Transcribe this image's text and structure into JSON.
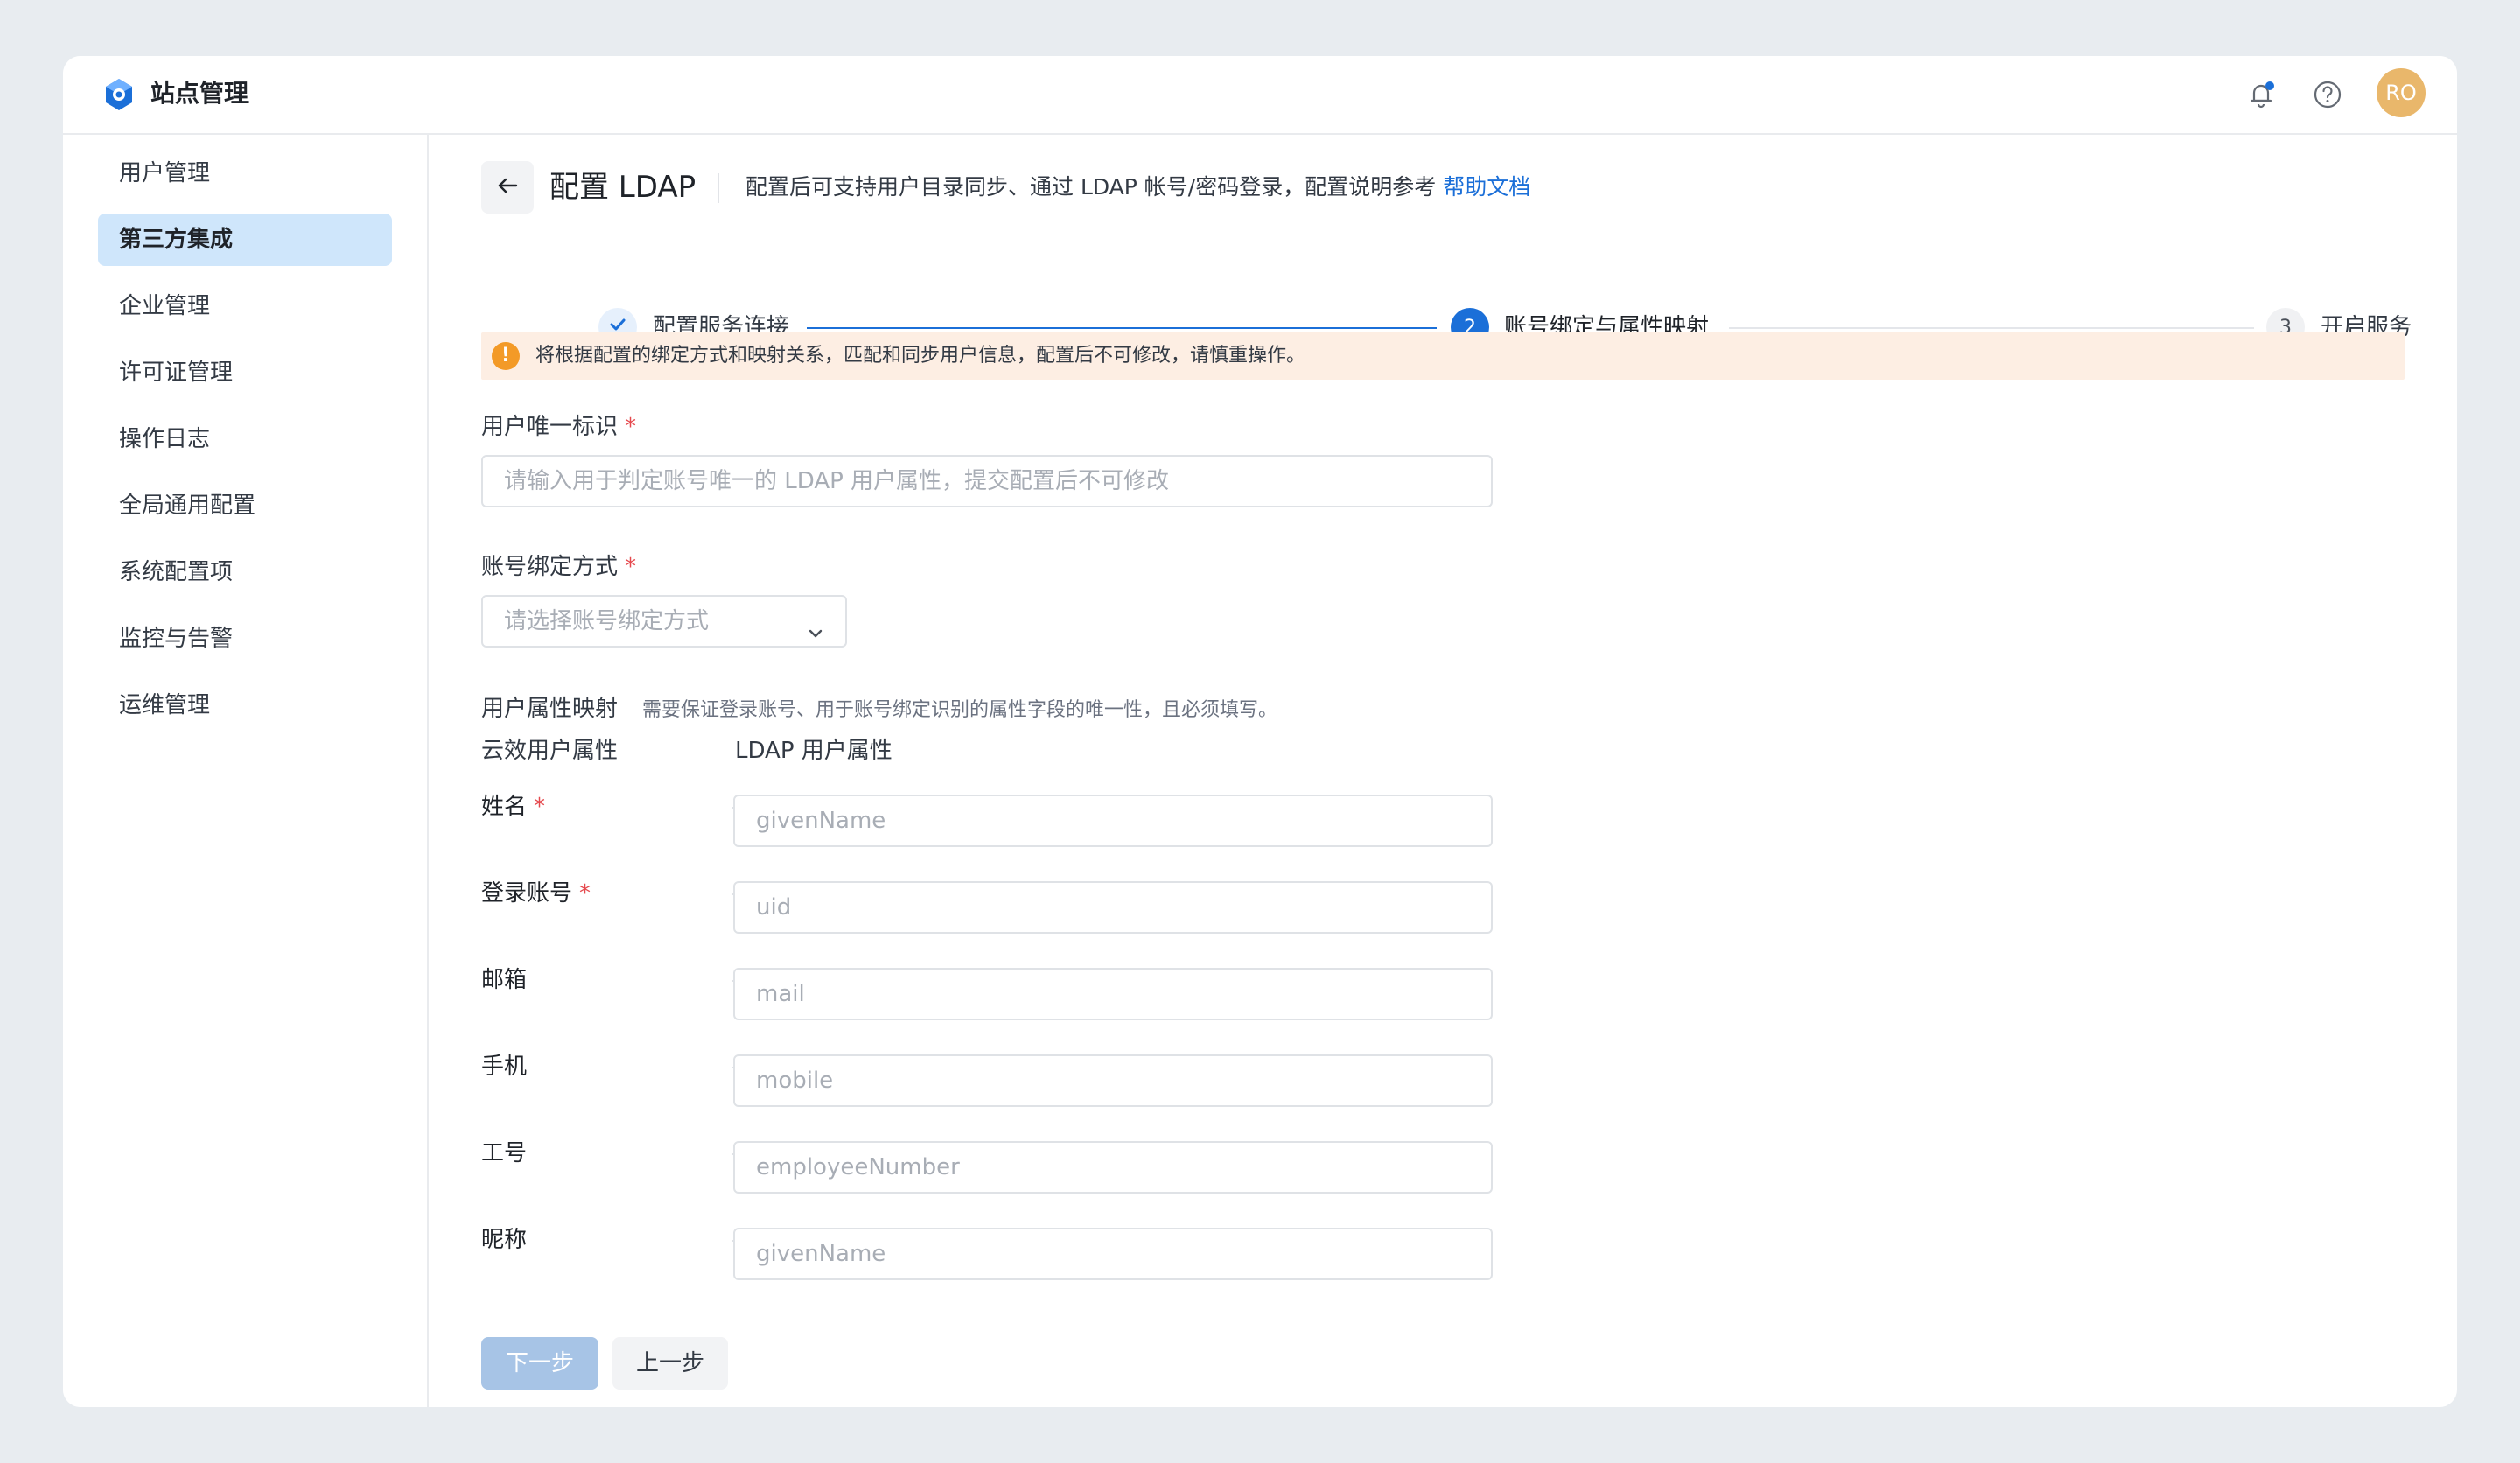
{
  "app": {
    "title": "站点管理",
    "avatar_initials": "RO"
  },
  "colors": {
    "accent": "#1b6fd8",
    "active_nav_bg": "#cfe6fb",
    "warning": "#f39a27",
    "warning_bg": "#fdeee3",
    "required": "#e5484d"
  },
  "icons": {
    "logo": "hexagon-logo-icon",
    "notification": "bell-icon",
    "help": "question-circle-icon",
    "back": "arrow-left-icon",
    "step_done": "check-icon",
    "warning": "exclamation-circle-icon",
    "dropdown": "chevron-down-icon"
  },
  "sidebar": {
    "items": [
      {
        "label": "用户管理",
        "active": false
      },
      {
        "label": "第三方集成",
        "active": true
      },
      {
        "label": "企业管理",
        "active": false
      },
      {
        "label": "许可证管理",
        "active": false
      },
      {
        "label": "操作日志",
        "active": false
      },
      {
        "label": "全局通用配置",
        "active": false
      },
      {
        "label": "系统配置项",
        "active": false
      },
      {
        "label": "监控与告警",
        "active": false
      },
      {
        "label": "运维管理",
        "active": false
      }
    ]
  },
  "page": {
    "title": "配置 LDAP",
    "description": "配置后可支持用户目录同步、通过 LDAP 帐号/密码登录，配置说明参考",
    "help_link": "帮助文档"
  },
  "steps": [
    {
      "label": "配置服务连接",
      "status": "done"
    },
    {
      "number": "2",
      "label": "账号绑定与属性映射",
      "status": "current"
    },
    {
      "number": "3",
      "label": "开启服务",
      "status": "pending"
    }
  ],
  "warning": {
    "text": "将根据配置的绑定方式和映射关系，匹配和同步用户信息，配置后不可修改，请慎重操作。"
  },
  "form": {
    "unique_id": {
      "label": "用户唯一标识",
      "required_mark": "*",
      "placeholder": "请输入用于判定账号唯一的 LDAP 用户属性，提交配置后不可修改",
      "value": ""
    },
    "bind_method": {
      "label": "账号绑定方式",
      "required_mark": "*",
      "placeholder": "请选择账号绑定方式",
      "selected": ""
    },
    "attribute_mapping": {
      "label": "用户属性映射",
      "hint": "需要保证登录账号、用于账号绑定识别的属性字段的唯一性，且必须填写。",
      "col_left": "云效用户属性",
      "col_right": "LDAP 用户属性",
      "rows": [
        {
          "label": "姓名",
          "required_mark": "*",
          "placeholder": "givenName"
        },
        {
          "label": "登录账号",
          "required_mark": "*",
          "placeholder": "uid"
        },
        {
          "label": "邮箱",
          "required_mark": "",
          "placeholder": "mail"
        },
        {
          "label": "手机",
          "required_mark": "",
          "placeholder": "mobile"
        },
        {
          "label": "工号",
          "required_mark": "",
          "placeholder": "employeeNumber"
        },
        {
          "label": "昵称",
          "required_mark": "",
          "placeholder": "givenName"
        }
      ]
    }
  },
  "buttons": {
    "next": "下一步",
    "prev": "上一步"
  }
}
